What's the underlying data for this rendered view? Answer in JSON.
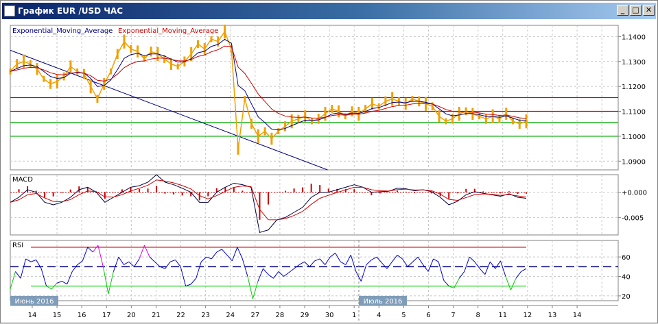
{
  "window": {
    "title": "График EUR /USD  ЧАС",
    "buttons": [
      "_",
      "□",
      "✕"
    ]
  },
  "legend": {
    "ema1": "Exponential_Moving_Average",
    "ema2": "Exponential_Moving_Average",
    "ema1_color": "#000080",
    "ema2_color": "#cc0000"
  },
  "chart_data": [
    {
      "type": "line",
      "title": "EUR/USD H1",
      "ylim": [
        1.0865,
        1.1445
      ],
      "yticks": [
        "1.1400",
        "1.1300",
        "1.1200",
        "1.1100",
        "1.1000",
        "1.0900"
      ],
      "ytick_values": [
        1.14,
        1.13,
        1.12,
        1.11,
        1.1,
        1.09
      ],
      "price": [
        1.126,
        1.129,
        1.13,
        1.129,
        1.127,
        1.123,
        1.121,
        1.122,
        1.124,
        1.128,
        1.126,
        1.125,
        1.12,
        1.115,
        1.121,
        1.126,
        1.133,
        1.138,
        1.135,
        1.134,
        1.131,
        1.134,
        1.133,
        1.131,
        1.129,
        1.128,
        1.13,
        1.133,
        1.137,
        1.135,
        1.139,
        1.138,
        1.142,
        1.135,
        1.095,
        1.115,
        1.105,
        1.1,
        1.102,
        1.099,
        1.102,
        1.104,
        1.106,
        1.107,
        1.108,
        1.106,
        1.107,
        1.109,
        1.111,
        1.11,
        1.108,
        1.11,
        1.109,
        1.111,
        1.113,
        1.112,
        1.114,
        1.115,
        1.114,
        1.113,
        1.115,
        1.114,
        1.113,
        1.112,
        1.108,
        1.106,
        1.107,
        1.109,
        1.11,
        1.109,
        1.108,
        1.107,
        1.108,
        1.107,
        1.109,
        1.106,
        1.105,
        1.106
      ],
      "hlines": [
        {
          "value": 1.1155,
          "color": "#cc0000"
        },
        {
          "value": 1.11,
          "color": "#cc0000"
        },
        {
          "value": 1.1055,
          "color": "#00aa00"
        },
        {
          "value": 1.1,
          "color": "#00aa00"
        }
      ],
      "trendline": {
        "from": [
          0,
          1.1345
        ],
        "to": [
          12.3,
          1.0865
        ],
        "color": "#000080"
      }
    },
    {
      "type": "line",
      "title": "MACD",
      "ylim": [
        -0.0085,
        0.0035
      ],
      "yticks": [
        "+0.000",
        "-0.005"
      ],
      "ytick_values": [
        0,
        -0.005
      ],
      "macd": [
        -0.002,
        -0.001,
        0.0005,
        0.0,
        -0.002,
        -0.0025,
        -0.002,
        -0.001,
        0.0005,
        0.001,
        0.0,
        -0.002,
        -0.001,
        0.0,
        0.001,
        0.0013,
        0.002,
        0.0035,
        0.002,
        0.0015,
        0.0008,
        0.0,
        -0.002,
        -0.002,
        0.0,
        0.001,
        0.0018,
        0.0015,
        0.001,
        -0.008,
        -0.0075,
        -0.0055,
        -0.005,
        -0.004,
        -0.003,
        -0.001,
        0.0,
        0.0,
        0.0005,
        0.001,
        0.0015,
        0.001,
        0.0,
        0.0001,
        0.0002,
        0.0008,
        0.0007,
        0.0003,
        0.0005,
        0.0001,
        -0.001,
        -0.0025,
        -0.0018,
        -0.0005,
        0.0001,
        -0.0002,
        -0.0005,
        -0.0008,
        -0.0003,
        -0.001,
        -0.0012
      ]
    },
    {
      "type": "line",
      "title": "RSI",
      "ylim": [
        15,
        77
      ],
      "yticks": [
        "60",
        "40",
        "20"
      ],
      "ytick_values": [
        60,
        40,
        20
      ],
      "levels": [
        70,
        50,
        30
      ],
      "rsi": [
        27,
        45,
        38,
        58,
        55,
        57,
        48,
        30,
        27,
        33,
        35,
        32,
        45,
        52,
        56,
        70,
        65,
        72,
        50,
        22,
        45,
        60,
        52,
        55,
        50,
        58,
        72,
        60,
        55,
        50,
        48,
        55,
        57,
        50,
        30,
        32,
        38,
        55,
        60,
        58,
        65,
        68,
        62,
        56,
        70,
        58,
        40,
        17,
        35,
        48,
        42,
        38,
        45,
        40,
        44,
        48,
        52,
        55,
        50,
        56,
        58,
        52,
        60,
        64,
        55,
        52,
        62,
        45,
        35,
        52,
        57,
        60,
        54,
        48,
        55,
        62,
        58,
        50,
        55,
        60,
        52,
        45,
        58,
        55,
        36,
        30,
        28,
        38,
        45,
        60,
        55,
        48,
        42,
        55,
        48,
        56,
        40,
        26,
        38,
        45,
        48
      ]
    },
    {
      "type": "axis",
      "xticks": [
        "14",
        "15",
        "16",
        "17",
        "20",
        "21",
        "22",
        "23",
        "24",
        "27",
        "28",
        "29",
        "30",
        "1",
        "4",
        "5",
        "6",
        "7",
        "8",
        "11",
        "12",
        "13",
        "14"
      ],
      "month_labels": [
        "Июнь 2016",
        "Июль 2016"
      ]
    }
  ],
  "panels": {
    "macd_label": "MACD",
    "rsi_label": "RSI"
  }
}
